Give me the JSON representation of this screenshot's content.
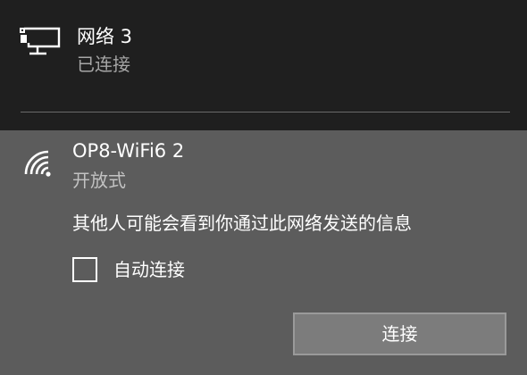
{
  "wired_network": {
    "name": "网络 3",
    "status": "已连接",
    "icon": "wired-network-icon"
  },
  "wifi_network": {
    "name": "OP8-WiFi6 2",
    "security": "开放式",
    "icon": "wifi-signal-icon",
    "warning": "其他人可能会看到你通过此网络发送的信息",
    "auto_connect_label": "自动连接",
    "auto_connect_checked": false,
    "connect_label": "连接"
  },
  "colors": {
    "panel_bg": "#1f1f1f",
    "selected_bg": "#5c5c5c",
    "button_bg": "#7c7c7c",
    "secondary_text": "#a6a6a6"
  }
}
